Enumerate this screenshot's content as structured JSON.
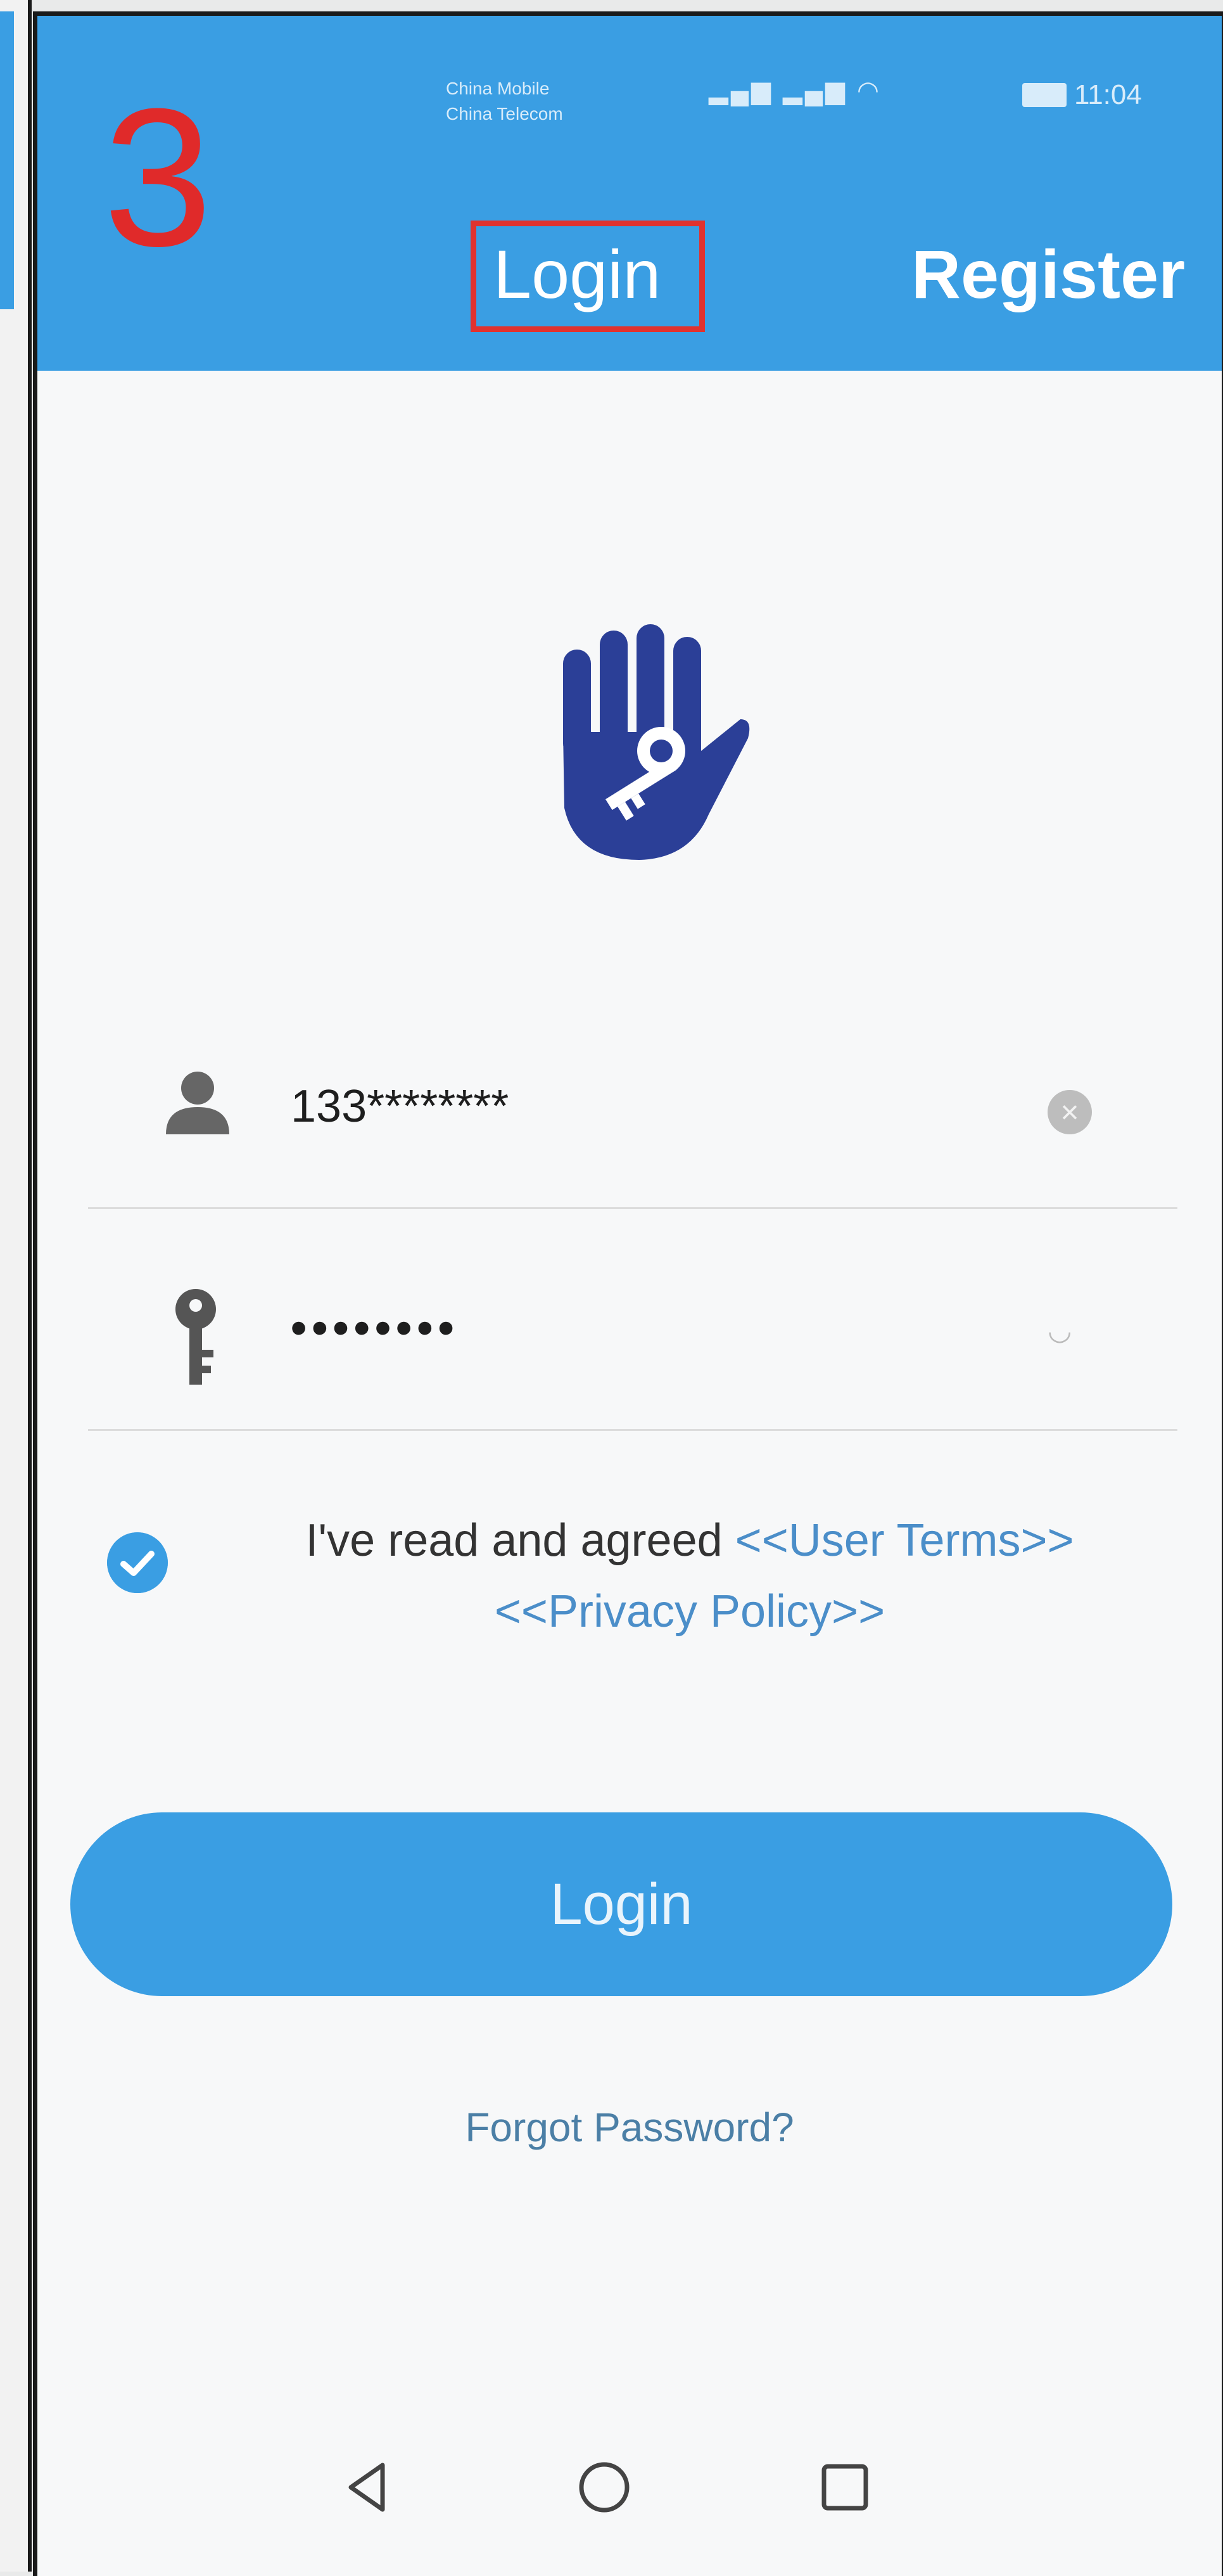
{
  "annotation": {
    "step_number": "3"
  },
  "status_bar": {
    "carrier_1": "China Mobile",
    "carrier_2": "China Telecom",
    "time": "11:04"
  },
  "header": {
    "tabs": [
      {
        "label": "Login",
        "highlighted": true
      },
      {
        "label": "Register",
        "highlighted": false
      }
    ]
  },
  "form": {
    "phone_value": "133********",
    "password_value": "••••••••"
  },
  "agreement": {
    "checked": true,
    "text": "I've read and agreed",
    "user_terms_link": "<<User Terms>>",
    "privacy_policy_link": "<<Privacy Policy>>"
  },
  "actions": {
    "login_label": "Login",
    "forgot_password_label": "Forgot Password?"
  },
  "colors": {
    "primary": "#3a9ee3",
    "logo": "#2b3f97",
    "annotation": "#e0322f",
    "link": "#4b8ec9"
  },
  "icons": [
    "user-icon",
    "key-icon",
    "clear-icon",
    "eye-icon",
    "check-icon",
    "hand-key-logo",
    "nav-back-icon",
    "nav-home-icon",
    "nav-recent-icon"
  ]
}
